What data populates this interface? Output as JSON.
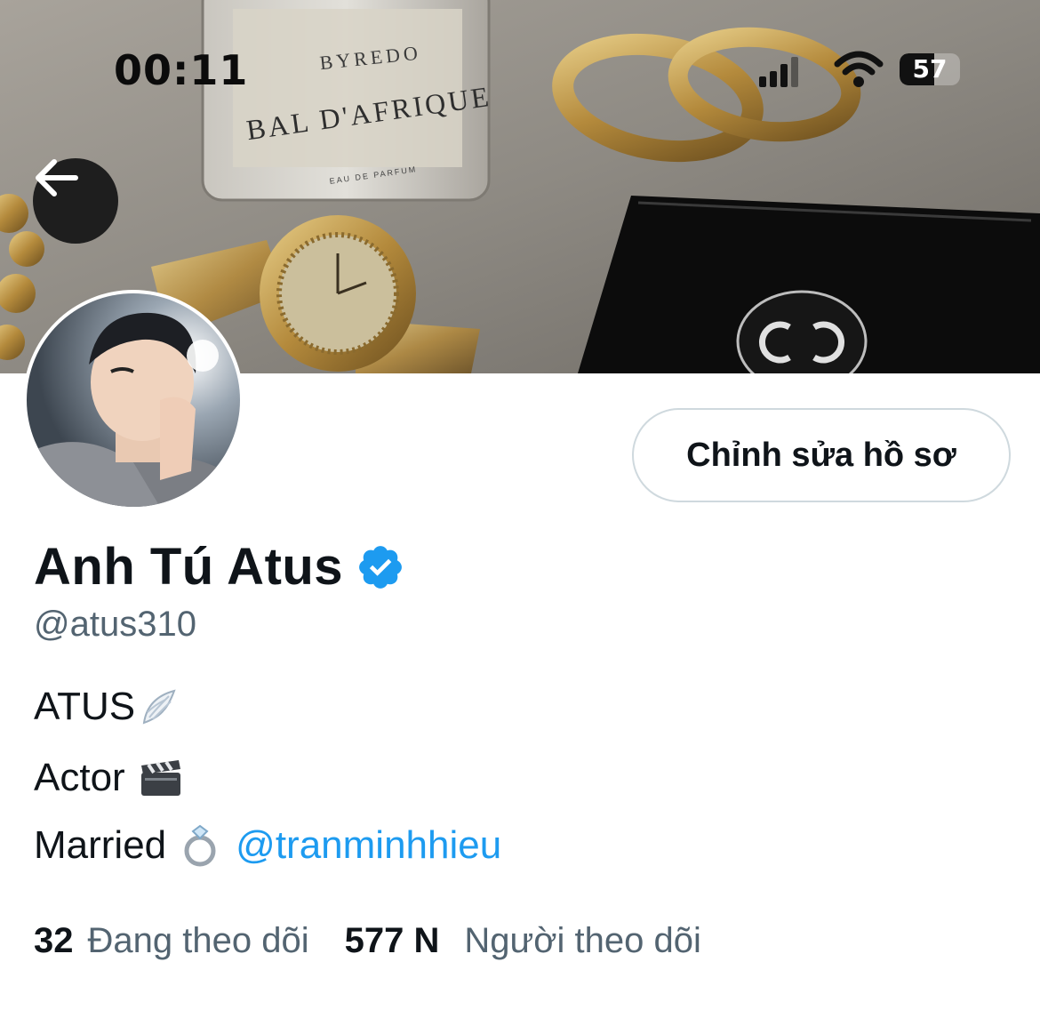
{
  "status_bar": {
    "time": "00:11",
    "battery": "57",
    "battery_level": 0.57
  },
  "banner": {
    "bottle_brand": "BYREDO",
    "bottle_name": "BAL D'AFRIQUE",
    "bottle_sub": "EAU DE PARFUM"
  },
  "profile": {
    "edit_label": "Chỉnh sửa hồ sơ",
    "display_name": "Anh Tú Atus",
    "handle": "@atus310",
    "bio": {
      "line1": "ATUS",
      "line2": "Actor",
      "line3": "Married",
      "mention": "@tranminhhieu"
    },
    "following_count": "32",
    "following_label": "Đang theo dõi",
    "followers_count": "577 N",
    "followers_label": "Người theo dõi"
  },
  "colors": {
    "link": "#1d9bf0",
    "secondary_text": "#536471",
    "verified": "#1d9bf0"
  },
  "icons": {
    "back": "arrow-left-icon",
    "verified": "verified-badge-icon",
    "wing": "wing-emoji-icon",
    "clapper": "clapper-board-emoji-icon",
    "ring": "ring-emoji-icon"
  }
}
